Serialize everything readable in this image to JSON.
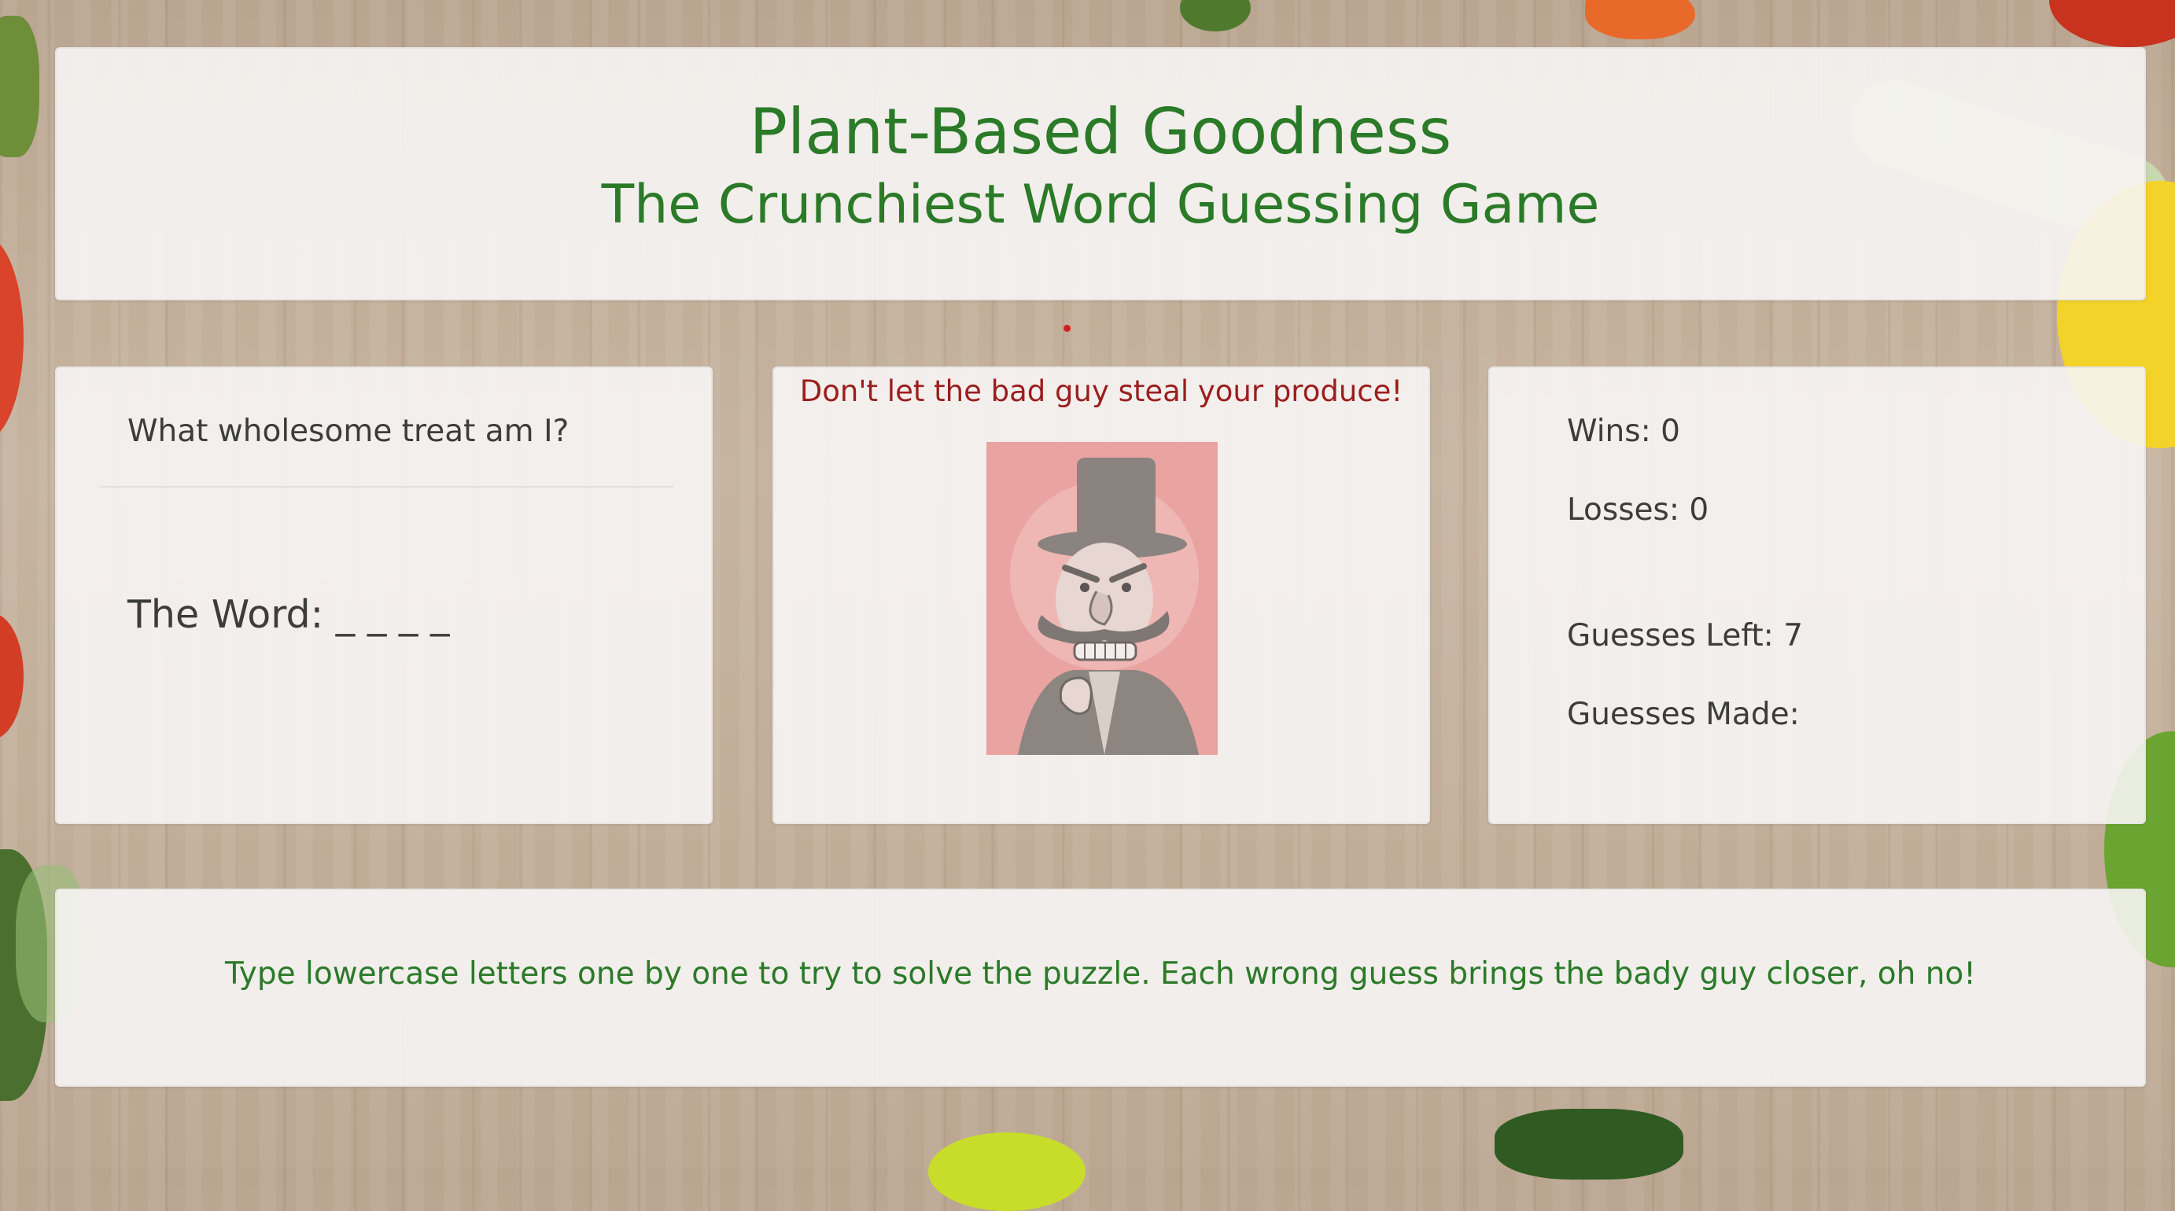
{
  "header": {
    "title": "Plant-Based Goodness",
    "subtitle": "The Crunchiest Word Guessing Game"
  },
  "word_panel": {
    "prompt": "What wholesome treat am I?",
    "word_label": "The Word:",
    "word_display": "_ _ _ _"
  },
  "villain_panel": {
    "warning": "Don't let the bad guy steal your produce!",
    "image_icon": "mustached-villain-icon"
  },
  "stats": {
    "wins_label": "Wins:",
    "wins": "0",
    "losses_label": "Losses:",
    "losses": "0",
    "guesses_left_label": "Guesses Left:",
    "guesses_left": "7",
    "guesses_made_label": "Guesses Made:",
    "guesses_made": ""
  },
  "footer": {
    "instructions": "Type lowercase letters one by one to try to solve the puzzle. Each wrong guess brings the bady guy closer, oh no!"
  },
  "colors": {
    "title_green": "#2a7a28",
    "warning_red": "#9b1e1e",
    "body_text": "#3c3c3c",
    "panel_bg": "#f7f5f4"
  }
}
